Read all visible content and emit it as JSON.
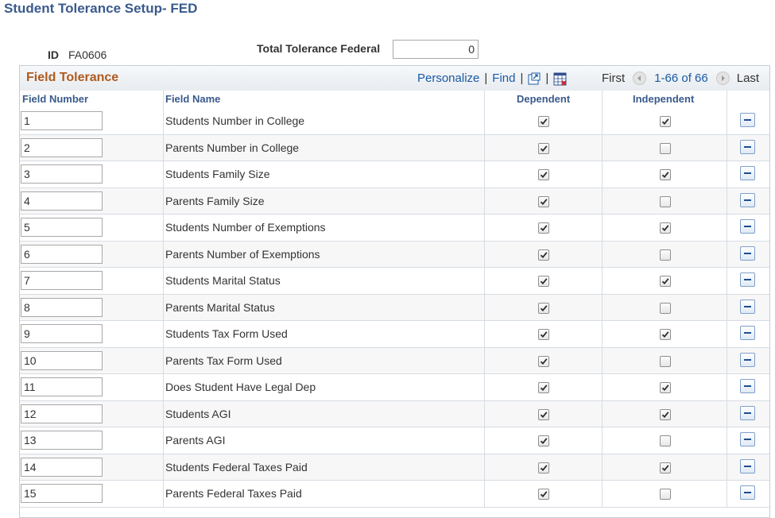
{
  "page": {
    "title": "Student Tolerance Setup- FED",
    "id_label": "ID",
    "id_value": "FA0606",
    "total_tolerance_label": "Total Tolerance Federal",
    "total_tolerance_value": "0"
  },
  "grid": {
    "title": "Field Tolerance",
    "personalize": "Personalize",
    "find": "Find",
    "separator": "|",
    "first": "First",
    "range": "1-66 of 66",
    "last": "Last",
    "columns": {
      "field_number": "Field Number",
      "field_name": "Field Name",
      "dependent": "Dependent",
      "independent": "Independent"
    },
    "rows": [
      {
        "number": "1",
        "name": "Students Number in College",
        "dependent": true,
        "independent": true
      },
      {
        "number": "2",
        "name": "Parents Number in College",
        "dependent": true,
        "independent": false
      },
      {
        "number": "3",
        "name": "Students Family Size",
        "dependent": true,
        "independent": true
      },
      {
        "number": "4",
        "name": "Parents Family Size",
        "dependent": true,
        "independent": false
      },
      {
        "number": "5",
        "name": "Students Number of Exemptions",
        "dependent": true,
        "independent": true
      },
      {
        "number": "6",
        "name": "Parents Number of Exemptions",
        "dependent": true,
        "independent": false
      },
      {
        "number": "7",
        "name": "Students Marital Status",
        "dependent": true,
        "independent": true
      },
      {
        "number": "8",
        "name": "Parents Marital Status",
        "dependent": true,
        "independent": false
      },
      {
        "number": "9",
        "name": "Students Tax Form Used",
        "dependent": true,
        "independent": true
      },
      {
        "number": "10",
        "name": "Parents Tax Form Used",
        "dependent": true,
        "independent": false
      },
      {
        "number": "11",
        "name": "Does Student Have Legal Dep",
        "dependent": true,
        "independent": true
      },
      {
        "number": "12",
        "name": "Students AGI",
        "dependent": true,
        "independent": true
      },
      {
        "number": "13",
        "name": "Parents AGI",
        "dependent": true,
        "independent": false
      },
      {
        "number": "14",
        "name": "Students Federal Taxes Paid",
        "dependent": true,
        "independent": true
      },
      {
        "number": "15",
        "name": "Parents Federal Taxes Paid",
        "dependent": true,
        "independent": false
      }
    ]
  },
  "icons": {
    "zoom": "zoom-window-icon",
    "download": "download-to-excel-icon",
    "prev": "previous-arrow-icon",
    "next": "next-arrow-icon",
    "delete": "delete-row-icon"
  },
  "colors": {
    "title": "#3a5a8c",
    "grid_title": "#b05a1e",
    "link": "#1a5aa5"
  }
}
